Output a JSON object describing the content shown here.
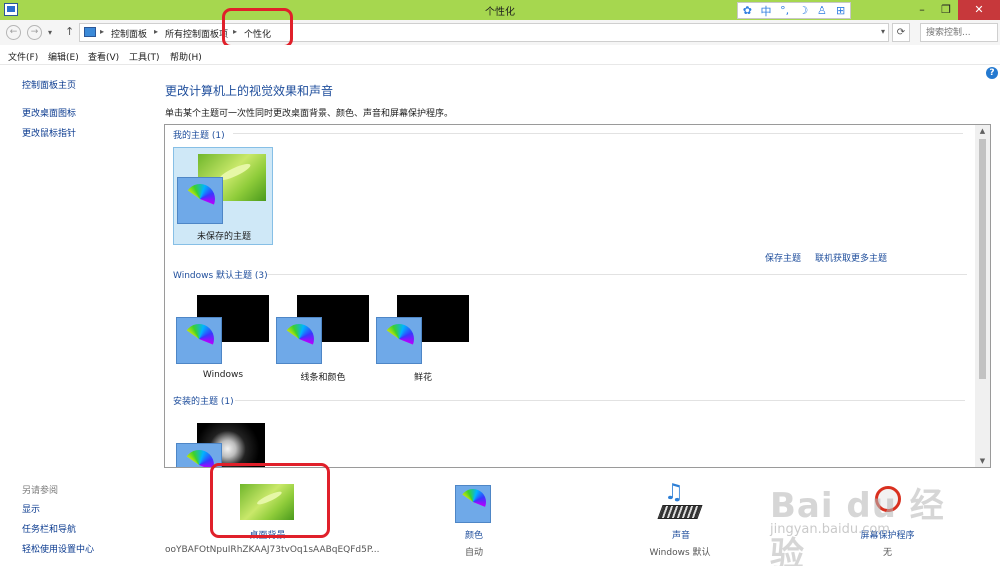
{
  "window": {
    "title": "个性化"
  },
  "ime": {
    "items": [
      "✿",
      "中",
      "°,",
      "☽",
      "♙",
      "⊞"
    ]
  },
  "address": {
    "crumbs": [
      "控制面板",
      "所有控制面板项",
      "个性化"
    ],
    "search_placeholder": "搜索控制..."
  },
  "menu": {
    "items": [
      "文件(F)",
      "编辑(E)",
      "查看(V)",
      "工具(T)",
      "帮助(H)"
    ]
  },
  "sidebar": {
    "links": [
      "控制面板主页",
      "更改桌面图标",
      "更改鼠标指针"
    ],
    "see_also_label": "另请参阅",
    "see_also": [
      "显示",
      "任务栏和导航",
      "轻松使用设置中心"
    ]
  },
  "main": {
    "title": "更改计算机上的视觉效果和声音",
    "description": "单击某个主题可一次性同时更改桌面背景、颜色、声音和屏幕保护程序。"
  },
  "themes": {
    "my_header": "我的主题 (1)",
    "my_theme_name": "未保存的主题",
    "save_theme": "保存主题",
    "get_more": "联机获取更多主题",
    "default_header": "Windows 默认主题 (3)",
    "default_names": [
      "Windows",
      "线条和颜色",
      "鲜花"
    ],
    "installed_header": "安装的主题 (1)"
  },
  "bottom": {
    "background_label": "桌面背景",
    "background_value": "ooYBAFOtNpuIRhZKAAJ73tvOq1sAABqEQFd5P...",
    "color_label": "颜色",
    "color_value": "自动",
    "sound_label": "声音",
    "sound_value": "Windows 默认",
    "saver_label": "屏幕保护程序",
    "saver_value": "无"
  },
  "watermark": {
    "logo": "Bai du 经验",
    "sub": "jingyan.baidu.com"
  },
  "colors": {
    "titlebar": "#a6d74f",
    "link": "#1f4e9c",
    "highlight": "#e0202a"
  }
}
